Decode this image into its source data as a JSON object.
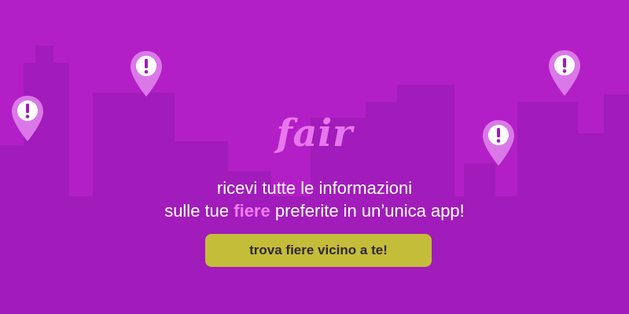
{
  "banner": {
    "logo": "fair",
    "tagline_line1": "ricevi tutte le informazioni",
    "tagline_line2_before": "sulle tue ",
    "tagline_highlight": "fiere",
    "tagline_line2_after": " preferite in un’unica app!",
    "cta_label": "trova fiere vicino a te!"
  },
  "colors": {
    "background": "#b31fc6",
    "skyline": "#a11cba",
    "logo": "#e777ee",
    "highlight": "#f07ef6",
    "pin": "#db78e8",
    "cta_background": "#c4bd3a",
    "cta_text": "#2f2732"
  },
  "icons": [
    "location-pin-alert-icon"
  ]
}
